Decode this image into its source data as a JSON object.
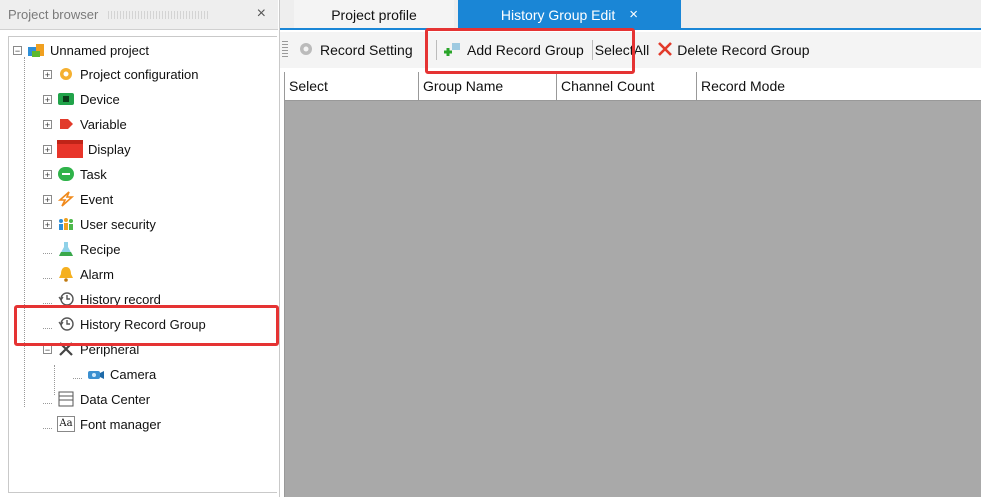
{
  "browser": {
    "title": "Project browser",
    "close": "×",
    "tree": [
      {
        "label": "Unnamed project",
        "icon": "project-icon",
        "expander": "−"
      },
      {
        "label": "Project configuration",
        "icon": "config-gear-icon",
        "expander": "+"
      },
      {
        "label": "Device",
        "icon": "device-icon",
        "expander": "+"
      },
      {
        "label": "Variable",
        "icon": "variable-tag-icon",
        "expander": "+"
      },
      {
        "label": "Display",
        "icon": "display-icon",
        "expander": "+"
      },
      {
        "label": "Task",
        "icon": "task-icon",
        "expander": "+"
      },
      {
        "label": "Event",
        "icon": "event-lightning-icon",
        "expander": "+"
      },
      {
        "label": "User security",
        "icon": "users-icon",
        "expander": "+"
      },
      {
        "label": "Recipe",
        "icon": "recipe-flask-icon"
      },
      {
        "label": "Alarm",
        "icon": "alarm-bell-icon"
      },
      {
        "label": "History record",
        "icon": "history-clock-icon"
      },
      {
        "label": "History Record Group",
        "icon": "history-group-clock-icon"
      },
      {
        "label": "Peripheral",
        "icon": "peripheral-tools-icon",
        "expander": "−"
      },
      {
        "label": "Camera",
        "icon": "camera-icon"
      },
      {
        "label": "Data Center",
        "icon": "data-center-icon"
      },
      {
        "label": "Font manager",
        "icon": "font-icon",
        "icon_text": "Aa"
      }
    ]
  },
  "tabs": [
    {
      "label": "Project profile",
      "active": false
    },
    {
      "label": "History Group Edit",
      "active": true,
      "close": "×"
    }
  ],
  "toolbar": {
    "record_setting": "Record Setting",
    "add_record_group": "Add Record Group",
    "select_all": "SelectAll",
    "delete_record_group": "Delete Record Group"
  },
  "grid": {
    "columns": [
      "Select",
      "Group Name",
      "Channel Count",
      "Record Mode"
    ],
    "rows": []
  },
  "colors": {
    "accent": "#1a86d6",
    "highlight": "#e53333",
    "grid_background": "#a9a9a9"
  }
}
